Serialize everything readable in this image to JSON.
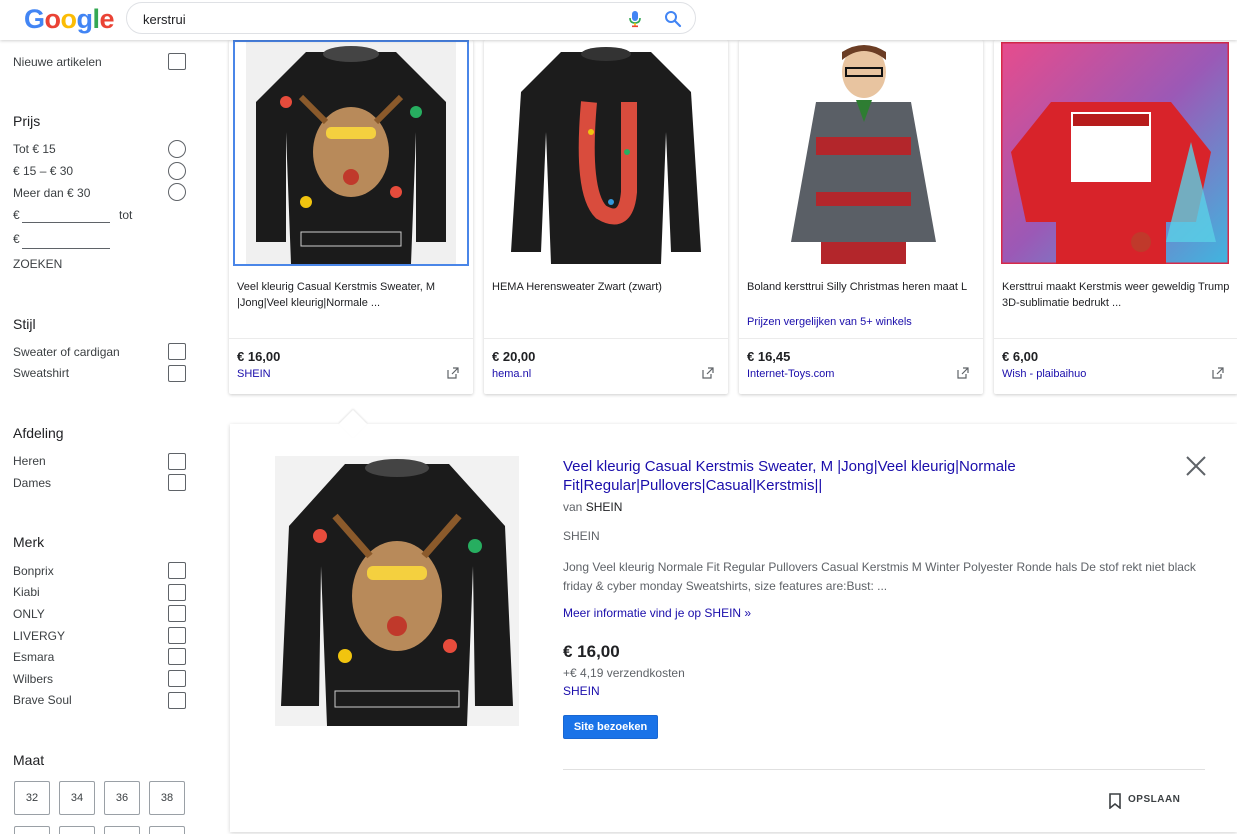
{
  "header": {
    "logo": [
      "G",
      "o",
      "o",
      "g",
      "l",
      "e"
    ],
    "logo_colors": [
      "#4285F4",
      "#EA4335",
      "#FBBC05",
      "#4285F4",
      "#34A853",
      "#EA4335"
    ],
    "search_value": "kerstrui"
  },
  "sidebar": {
    "new_items": "Nieuwe artikelen",
    "price": {
      "heading": "Prijs",
      "opt1": "Tot € 15",
      "opt2": "€ 15 – € 30",
      "opt3": "Meer dan € 30",
      "currency_from": "€",
      "to_label": "tot",
      "currency_to": "€",
      "search_label": "ZOEKEN"
    },
    "style": {
      "heading": "Stijl",
      "opt1": "Sweater of cardigan",
      "opt2": "Sweatshirt"
    },
    "department": {
      "heading": "Afdeling",
      "opt1": "Heren",
      "opt2": "Dames"
    },
    "brand": {
      "heading": "Merk",
      "opt1": "Bonprix",
      "opt2": "Kiabi",
      "opt3": "ONLY",
      "opt4": "LIVERGY",
      "opt5": "Esmara",
      "opt6": "Wilbers",
      "opt7": "Brave Soul"
    },
    "size": {
      "heading": "Maat",
      "s1": "32",
      "s2": "34",
      "s3": "36",
      "s4": "38"
    }
  },
  "cards": {
    "c1": {
      "title": "Veel kleurig Casual Kerstmis Sweater, M |Jong|Veel kleurig|Normale ...",
      "price": "€ 16,00",
      "store": "SHEIN"
    },
    "c2": {
      "title": "HEMA Herensweater Zwart (zwart)",
      "price": "€ 20,00",
      "store": "hema.nl"
    },
    "c3": {
      "title": "Boland kersttrui Silly Christmas heren maat L",
      "compare": "Prijzen vergelijken van 5+ winkels",
      "price": "€ 16,45",
      "store": "Internet-Toys.com"
    },
    "c4": {
      "title": "Kersttrui maakt Kerstmis weer geweldig Trump 3D-sublimatie bedrukt ...",
      "price": "€ 6,00",
      "store": "Wish - plaibaihuo"
    }
  },
  "detail": {
    "title": "Veel kleurig Casual Kerstmis Sweater, M |Jong|Veel kleurig|Normale Fit|Regular|Pullovers|Casual|Kerstmis||",
    "by_prefix": "van",
    "by_store": "SHEIN",
    "shop_name": "SHEIN",
    "description": "Jong Veel kleurig Normale Fit Regular Pullovers Casual Kerstmis M Winter Polyester Ronde hals De stof rekt niet black friday & cyber monday Sweatshirts, size features are:Bust: ...",
    "more_link": "Meer informatie vind je op SHEIN »",
    "price": "€ 16,00",
    "shipping": "+€ 4,19 verzendkosten",
    "store": "SHEIN",
    "visit_button": "Site bezoeken",
    "save_label": "OPSLAAN"
  }
}
